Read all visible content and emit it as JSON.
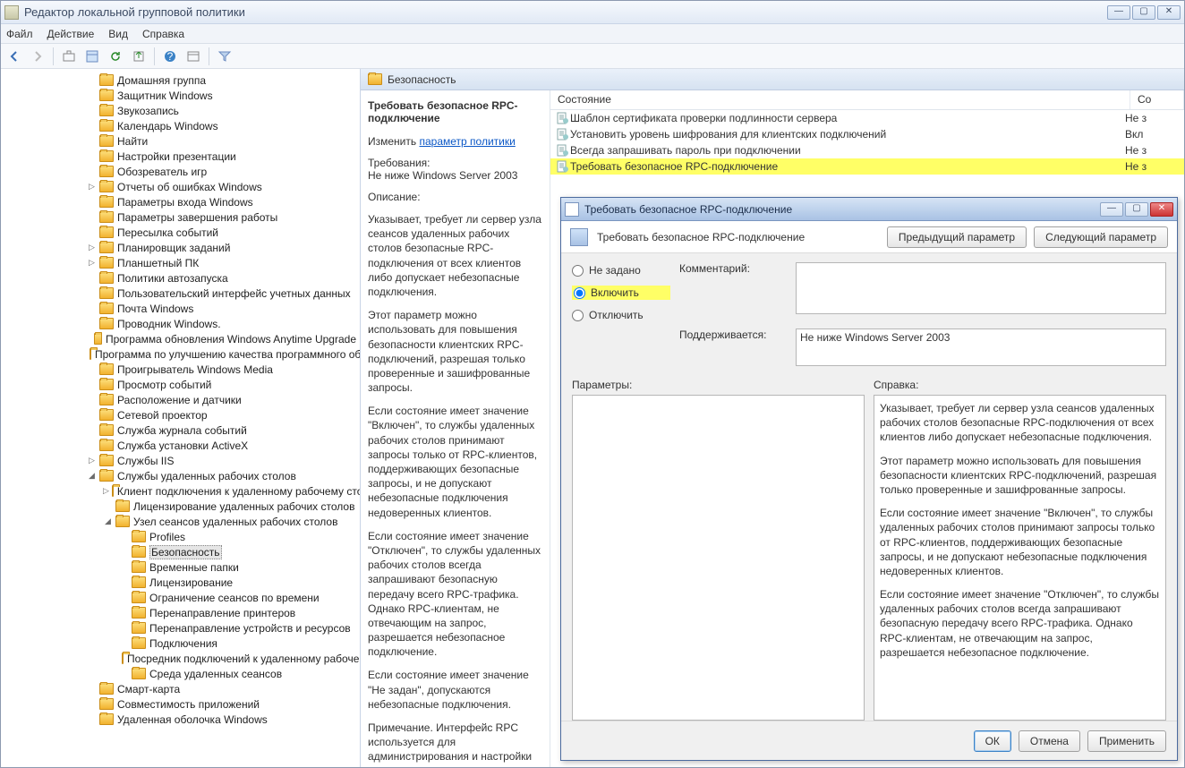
{
  "window": {
    "title": "Редактор локальной групповой политики",
    "menus": [
      "Файл",
      "Действие",
      "Вид",
      "Справка"
    ]
  },
  "tree": [
    {
      "indent": 2,
      "exp": "",
      "label": "Домашняя группа"
    },
    {
      "indent": 2,
      "exp": "",
      "label": "Защитник Windows"
    },
    {
      "indent": 2,
      "exp": "",
      "label": "Звукозапись"
    },
    {
      "indent": 2,
      "exp": "",
      "label": "Календарь Windows"
    },
    {
      "indent": 2,
      "exp": "",
      "label": "Найти"
    },
    {
      "indent": 2,
      "exp": "",
      "label": "Настройки презентации"
    },
    {
      "indent": 2,
      "exp": "",
      "label": "Обозреватель игр"
    },
    {
      "indent": 2,
      "exp": "▷",
      "label": "Отчеты об ошибках Windows"
    },
    {
      "indent": 2,
      "exp": "",
      "label": "Параметры входа Windows"
    },
    {
      "indent": 2,
      "exp": "",
      "label": "Параметры завершения работы"
    },
    {
      "indent": 2,
      "exp": "",
      "label": "Пересылка событий"
    },
    {
      "indent": 2,
      "exp": "▷",
      "label": "Планировщик заданий"
    },
    {
      "indent": 2,
      "exp": "▷",
      "label": "Планшетный ПК"
    },
    {
      "indent": 2,
      "exp": "",
      "label": "Политики автозапуска"
    },
    {
      "indent": 2,
      "exp": "",
      "label": "Пользовательский интерфейс учетных данных"
    },
    {
      "indent": 2,
      "exp": "",
      "label": "Почта Windows"
    },
    {
      "indent": 2,
      "exp": "",
      "label": "Проводник Windows."
    },
    {
      "indent": 2,
      "exp": "",
      "label": "Программа обновления Windows Anytime Upgrade"
    },
    {
      "indent": 2,
      "exp": "",
      "label": "Программа по улучшению качества программного обеспечения"
    },
    {
      "indent": 2,
      "exp": "",
      "label": "Проигрыватель Windows Media"
    },
    {
      "indent": 2,
      "exp": "",
      "label": "Просмотр событий"
    },
    {
      "indent": 2,
      "exp": "",
      "label": "Расположение и датчики"
    },
    {
      "indent": 2,
      "exp": "",
      "label": "Сетевой проектор"
    },
    {
      "indent": 2,
      "exp": "",
      "label": "Служба журнала событий"
    },
    {
      "indent": 2,
      "exp": "",
      "label": "Служба установки ActiveX"
    },
    {
      "indent": 2,
      "exp": "▷",
      "label": "Службы IIS"
    },
    {
      "indent": 2,
      "exp": "◢",
      "label": "Службы удаленных рабочих столов"
    },
    {
      "indent": 3,
      "exp": "▷",
      "label": "Клиент подключения к удаленному рабочему столу"
    },
    {
      "indent": 3,
      "exp": "",
      "label": "Лицензирование удаленных рабочих столов"
    },
    {
      "indent": 3,
      "exp": "◢",
      "label": "Узел сеансов удаленных рабочих столов"
    },
    {
      "indent": 4,
      "exp": "",
      "label": "Profiles"
    },
    {
      "indent": 4,
      "exp": "",
      "label": "Безопасность",
      "selected": true
    },
    {
      "indent": 4,
      "exp": "",
      "label": "Временные папки"
    },
    {
      "indent": 4,
      "exp": "",
      "label": "Лицензирование"
    },
    {
      "indent": 4,
      "exp": "",
      "label": "Ограничение сеансов по времени"
    },
    {
      "indent": 4,
      "exp": "",
      "label": "Перенаправление принтеров"
    },
    {
      "indent": 4,
      "exp": "",
      "label": "Перенаправление устройств и ресурсов"
    },
    {
      "indent": 4,
      "exp": "",
      "label": "Подключения"
    },
    {
      "indent": 4,
      "exp": "",
      "label": "Посредник подключений к удаленному рабочему столу"
    },
    {
      "indent": 4,
      "exp": "",
      "label": "Среда удаленных сеансов"
    },
    {
      "indent": 2,
      "exp": "",
      "label": "Смарт-карта"
    },
    {
      "indent": 2,
      "exp": "",
      "label": "Совместимость приложений"
    },
    {
      "indent": 2,
      "exp": "",
      "label": "Удаленная оболочка Windows"
    }
  ],
  "rightHeader": "Безопасность",
  "desc": {
    "policyName": "Требовать безопасное RPC-подключение",
    "changeLabel": "Изменить",
    "changeLink": "параметр политики",
    "requirementsLabel": "Требования:",
    "requirements": "Не ниже Windows Server 2003",
    "descriptionLabel": "Описание:",
    "paragraphs": [
      "Указывает, требует ли сервер узла сеансов удаленных рабочих столов безопасные RPC-подключения от всех клиентов либо допускает небезопасные подключения.",
      "Этот параметр можно использовать для повышения безопасности клиентских RPC-подключений, разрешая только проверенные и зашифрованные запросы.",
      "Если состояние имеет значение \"Включен\", то службы удаленных рабочих столов принимают запросы только от RPC-клиентов, поддерживающих безопасные запросы, и не допускают небезопасные подключения недоверенных клиентов.",
      "Если состояние имеет значение \"Отключен\", то службы удаленных рабочих столов всегда запрашивают безопасную передачу всего RPC-трафика. Однако RPC-клиентам, не отвечающим на запрос, разрешается небезопасное подключение.",
      "Если состояние имеет значение \"Не задан\", допускаются небезопасные подключения.",
      "Примечание. Интерфейс RPC используется для администрирования и настройки"
    ]
  },
  "listCols": {
    "name": "Состояние",
    "state": "Со"
  },
  "listRows": [
    {
      "name": "Шаблон сертификата проверки подлинности сервера",
      "state": "Не з"
    },
    {
      "name": "Установить уровень шифрования для клиентских подключений",
      "state": "Вкл"
    },
    {
      "name": "Всегда запрашивать пароль при подключении",
      "state": "Не з"
    },
    {
      "name": "Требовать безопасное RPC-подключение",
      "state": "Не з",
      "hl": true
    }
  ],
  "dialog": {
    "title": "Требовать безопасное RPC-подключение",
    "subTitle": "Требовать безопасное RPC-подключение",
    "prevBtn": "Предыдущий параметр",
    "nextBtn": "Следующий параметр",
    "radios": {
      "notset": "Не задано",
      "enable": "Включить",
      "disable": "Отключить"
    },
    "commentLabel": "Комментарий:",
    "supportLabel": "Поддерживается:",
    "supportText": "Не ниже Windows Server 2003",
    "paramsLabel": "Параметры:",
    "helpLabel": "Справка:",
    "helpParagraphs": [
      "Указывает, требует ли сервер узла сеансов удаленных рабочих столов безопасные RPC-подключения от всех клиентов либо допускает небезопасные подключения.",
      "Этот параметр можно использовать для повышения безопасности клиентских RPC-подключений, разрешая только проверенные и зашифрованные запросы.",
      "Если состояние имеет значение \"Включен\", то службы удаленных рабочих столов принимают запросы только от RPC-клиентов, поддерживающих безопасные запросы, и не допускают небезопасные подключения недоверенных клиентов.",
      "Если состояние имеет значение \"Отключен\", то службы удаленных рабочих столов всегда запрашивают безопасную передачу всего RPC-трафика. Однако RPC-клиентам, не отвечающим на запрос, разрешается небезопасное подключение."
    ],
    "ok": "ОК",
    "cancel": "Отмена",
    "apply": "Применить"
  }
}
